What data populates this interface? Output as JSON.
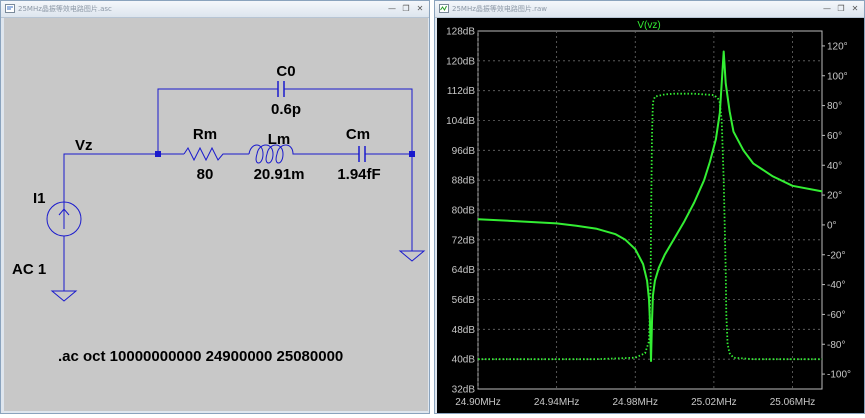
{
  "schematic_window": {
    "title": "25MHz晶振等效电路图片.asc",
    "controls": [
      "—",
      "❐",
      "✕"
    ]
  },
  "plot_window": {
    "title": "25MHz晶振等效电路图片.raw",
    "controls": [
      "—",
      "❐",
      "✕"
    ]
  },
  "schematic": {
    "node_label": "Vz",
    "source_name": "I1",
    "source_value": "AC 1",
    "components": [
      {
        "name": "C0",
        "value": "0.6p"
      },
      {
        "name": "Rm",
        "value": "80"
      },
      {
        "name": "Lm",
        "value": "20.91m"
      },
      {
        "name": "Cm",
        "value": "1.94fF"
      }
    ],
    "directive": ".ac oct 10000000000 24900000 25080000",
    "colors": {
      "wire": "#1a1acd",
      "node": "#1a1acd",
      "text": "#000000",
      "background": "#c8c8c8"
    }
  },
  "chart_data": {
    "type": "line",
    "title": "V(vz)",
    "left_axis": {
      "ticks": [
        "32dB",
        "40dB",
        "48dB",
        "56dB",
        "64dB",
        "72dB",
        "80dB",
        "88dB",
        "96dB",
        "104dB",
        "112dB",
        "120dB",
        "128dB"
      ],
      "range": [
        32,
        128
      ]
    },
    "right_axis": {
      "ticks": [
        "-100°",
        "-80°",
        "-60°",
        "-40°",
        "-20°",
        "0°",
        "20°",
        "40°",
        "60°",
        "80°",
        "100°",
        "120°"
      ],
      "range": [
        -110,
        130
      ]
    },
    "x_axis": {
      "ticks": [
        "24.90MHz",
        "24.94MHz",
        "24.98MHz",
        "25.02MHz",
        "25.06MHz"
      ],
      "range": [
        24.9,
        25.075
      ],
      "unit": "MHz"
    },
    "grid": true,
    "series": [
      {
        "kind": "magnitude",
        "axis": "left",
        "style": "solid",
        "color": "#33ee33",
        "x": [
          24.9,
          24.92,
          24.94,
          24.95,
          24.96,
          24.97,
          24.975,
          24.98,
          24.984,
          24.986,
          24.987,
          24.9875,
          24.988,
          24.9885,
          24.989,
          24.99,
          24.992,
          24.995,
          25.0,
          25.005,
          25.01,
          25.015,
          25.018,
          25.021,
          25.023,
          25.024,
          25.025,
          25.026,
          25.028,
          25.03,
          25.035,
          25.04,
          25.05,
          25.06,
          25.075
        ],
        "y": [
          77.5,
          77.0,
          76.4,
          75.8,
          75.0,
          73.5,
          72.0,
          69.5,
          65.5,
          61.0,
          56.0,
          50.0,
          39.5,
          50.0,
          57.0,
          61.0,
          64.5,
          68.0,
          72.5,
          77.0,
          82.0,
          88.0,
          93.0,
          99.0,
          106.0,
          114.0,
          122.5,
          114.0,
          106.5,
          101.0,
          96.0,
          92.5,
          89.0,
          86.5,
          85.0
        ]
      },
      {
        "kind": "phase",
        "axis": "right",
        "style": "dotted",
        "color": "#33ee33",
        "x": [
          24.9,
          24.96,
          24.98,
          24.985,
          24.987,
          24.9878,
          24.988,
          24.9885,
          24.989,
          24.99,
          24.995,
          25.0,
          25.01,
          25.02,
          25.022,
          25.023,
          25.024,
          25.025,
          25.026,
          25.0263,
          25.027,
          25.028,
          25.03,
          25.04,
          25.075
        ],
        "y": [
          -90,
          -90,
          -89,
          -86,
          -78,
          -40,
          0,
          60,
          82,
          86,
          87.5,
          88,
          88,
          87,
          85,
          82,
          70,
          30,
          -30,
          -60,
          -80,
          -86,
          -89,
          -90,
          -90
        ]
      }
    ]
  }
}
